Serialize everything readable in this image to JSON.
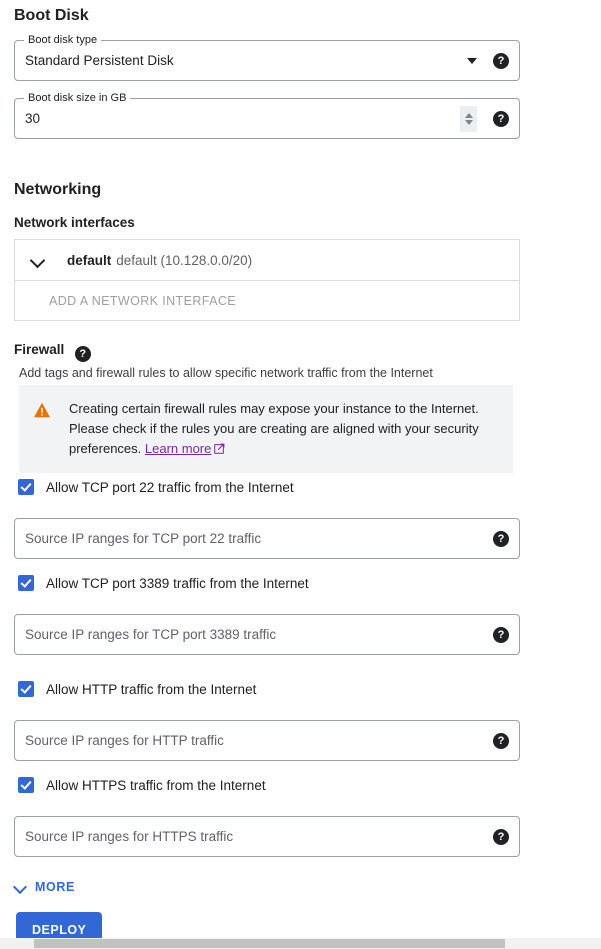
{
  "boot_disk": {
    "heading": "Boot Disk",
    "type_field": {
      "label": "Boot disk type",
      "value": "Standard Persistent Disk",
      "dropdown_icon": "chevron-down-icon",
      "help_icon": "help-icon"
    },
    "size_field": {
      "label": "Boot disk size in GB",
      "value": "30",
      "stepper_icon": "spinner-up-down-icon",
      "help_icon": "help-icon"
    }
  },
  "networking": {
    "heading": "Networking",
    "interfaces": {
      "sub_heading": "Network interfaces",
      "rows": [
        {
          "expand_icon": "chevron-down-icon",
          "name": "default",
          "description": "default (10.128.0.0/20)"
        }
      ],
      "add_label": "ADD A NETWORK INTERFACE"
    },
    "firewall": {
      "heading": "Firewall",
      "help_icon": "help-icon",
      "description": "Add tags and firewall rules to allow specific network traffic from the Internet",
      "warning": {
        "icon": "warning-triangle-icon",
        "text": "Creating certain firewall rules may expose your instance to the Internet. Please check if the rules you are creating are aligned with your security preferences.",
        "link_label": "Learn more",
        "link_icon": "external-link-icon",
        "icon_color": "#e8710a",
        "link_color": "#7b27a3",
        "background": "#f1f3f4"
      },
      "rules": [
        {
          "checkbox_label": "Allow TCP port 22 traffic from the Internet",
          "checked": true,
          "source_placeholder": "Source IP ranges for TCP port 22 traffic",
          "source_value": "",
          "help_icon": "help-icon"
        },
        {
          "checkbox_label": "Allow TCP port 3389 traffic from the Internet",
          "checked": true,
          "source_placeholder": "Source IP ranges for TCP port 3389 traffic",
          "source_value": "",
          "help_icon": "help-icon"
        },
        {
          "checkbox_label": "Allow HTTP traffic from the Internet",
          "checked": true,
          "source_placeholder": "Source IP ranges for HTTP traffic",
          "source_value": "",
          "help_icon": "help-icon"
        },
        {
          "checkbox_label": "Allow HTTPS traffic from the Internet",
          "checked": true,
          "source_placeholder": "Source IP ranges for HTTPS traffic",
          "source_value": "",
          "help_icon": "help-icon"
        }
      ]
    }
  },
  "footer": {
    "more_label": "MORE",
    "more_icon": "chevron-down-icon",
    "deploy_label": "DEPLOY",
    "accent_color": "#3367d6"
  }
}
